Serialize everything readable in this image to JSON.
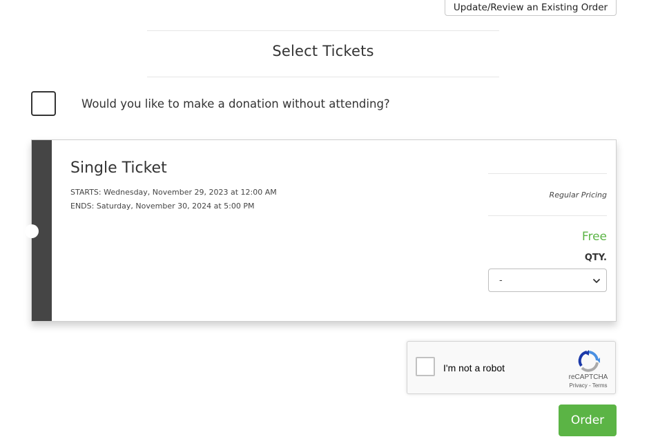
{
  "header": {
    "update_button_label": "Update/Review an Existing Order"
  },
  "section": {
    "title": "Select Tickets"
  },
  "donation": {
    "checked": false,
    "label": "Would you like to make a donation without attending?"
  },
  "ticket": {
    "name": "Single Ticket",
    "starts": "STARTS: Wednesday, November 29, 2023 at 12:00 AM",
    "ends": "ENDS: Saturday, November 30, 2024 at 5:00 PM",
    "pricing_label": "Regular Pricing",
    "price": "Free",
    "qty_label": "QTY.",
    "qty_selected": "-"
  },
  "recaptcha": {
    "label": "I'm not a robot",
    "brand": "reCAPTCHA",
    "privacy": "Privacy",
    "separator": " - ",
    "terms": "Terms"
  },
  "footer": {
    "order_button_label": "Order"
  },
  "colors": {
    "accent_green": "#5bb445",
    "card_stripe": "#454545"
  }
}
